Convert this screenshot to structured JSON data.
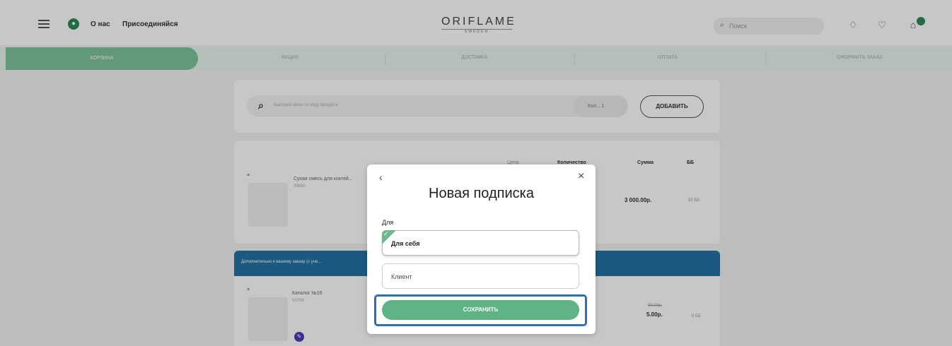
{
  "header": {
    "about_label": "О нас",
    "join_label": "Присоединяйся",
    "logo_main": "ORIFLAME",
    "logo_sub": "SWEDEN",
    "search_placeholder": "Поиск",
    "cart_count": ""
  },
  "steps": [
    "КОРЗИНА",
    "АКЦИИ",
    "ДОСТАВКА",
    "ОПЛАТА",
    "ОФОРМИТЬ ЗАКАЗ"
  ],
  "quick_order": {
    "placeholder": "Быстрый заказ по коду продукта",
    "qty_placeholder": "Кол... 1",
    "add_label": "ДОБАВИТЬ"
  },
  "cart_table": {
    "headers": [
      "Цена",
      "Количество",
      "Сумма",
      "ББ"
    ],
    "items": [
      {
        "name": "Сухая смесь для коктей...",
        "code": "39690",
        "sum": "3 000.00р.",
        "bb": "52 ББ"
      }
    ]
  },
  "extras": {
    "bar_text": "Дополнительно к вашему заказу (с уче...",
    "items": [
      {
        "name": "Каталог №16",
        "code": "50706",
        "old_price": "59.00р.",
        "price": "5.00р.",
        "bb": "0 ББ"
      }
    ]
  },
  "modal": {
    "back_icon": "‹",
    "close_icon": "×",
    "title": "Новая подписка",
    "for_label": "Для",
    "options": [
      {
        "label": "Для себя",
        "selected": true
      },
      {
        "label": "Клиент",
        "selected": false
      }
    ],
    "save_label": "СОХРАНИТЬ"
  },
  "colors": {
    "brand_green": "#5fb384",
    "extras_blue": "#2472a4",
    "highlight_blue": "#2f6fb3"
  }
}
